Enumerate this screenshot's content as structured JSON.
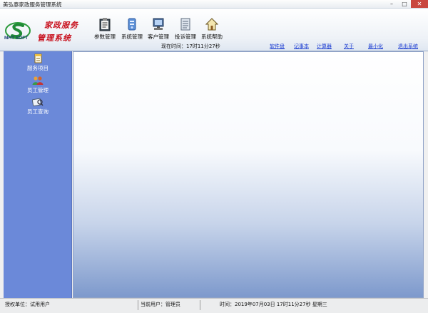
{
  "window": {
    "title": "美弘泰家政服务管理系统"
  },
  "brand": {
    "logo_text": "MHT SOFT",
    "line1": "家政服务",
    "line2": "管理系统"
  },
  "toolbar": [
    {
      "label": "参数管理",
      "icon": "clipboard-icon"
    },
    {
      "label": "系统管理",
      "icon": "settings-icon"
    },
    {
      "label": "客户管理",
      "icon": "computer-icon"
    },
    {
      "label": "投诉管理",
      "icon": "document-icon"
    },
    {
      "label": "系统帮助",
      "icon": "home-icon"
    }
  ],
  "clock": {
    "text": "现在时间：17时11分27秒"
  },
  "links": [
    {
      "label": "软件盘"
    },
    {
      "label": "记事本"
    },
    {
      "label": "计算器"
    },
    {
      "label": "关于"
    },
    {
      "label": "最小化"
    },
    {
      "label": "退出系统"
    }
  ],
  "sidebar": [
    {
      "label": "服务项目",
      "icon": "document-icon"
    },
    {
      "label": "员工管理",
      "icon": "people-icon"
    },
    {
      "label": "员工查询",
      "icon": "search-people-icon"
    }
  ],
  "status": {
    "org": "授权单位：试用用户",
    "user": "当前用户：管理员",
    "time": "时间：2019年07月03日  17时11分27秒  星期三"
  }
}
